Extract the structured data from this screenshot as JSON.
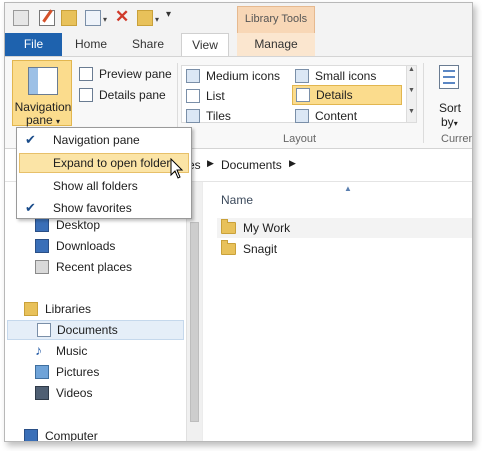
{
  "contextual_tab": {
    "label": "Library Tools"
  },
  "tabs": {
    "file": "File",
    "home": "Home",
    "share": "Share",
    "view": "View",
    "manage": "Manage"
  },
  "ribbon": {
    "navigation_pane_line1": "Navigation",
    "navigation_pane_line2": "pane",
    "preview_pane": "Preview pane",
    "details_pane": "Details pane",
    "layout": {
      "medium_icons": "Medium icons",
      "small_icons": "Small icons",
      "list": "List",
      "details": "Details",
      "tiles": "Tiles",
      "content": "Content",
      "group_label": "Layout"
    },
    "sort_line1": "Sort",
    "sort_line2": "by",
    "current_group_partial": "Curren"
  },
  "address_bar": {
    "libraries_partial": "es",
    "documents": "Documents"
  },
  "nav_menu": {
    "items": [
      {
        "label": "Navigation pane",
        "checked": true
      },
      {
        "label": "Expand to open folder",
        "checked": false,
        "highlighted": true
      },
      {
        "label": "Show all folders",
        "checked": false
      },
      {
        "label": "Show favorites",
        "checked": true
      }
    ]
  },
  "nav_pane": {
    "desktop": "Desktop",
    "downloads": "Downloads",
    "recent_places": "Recent places",
    "libraries": "Libraries",
    "documents": "Documents",
    "music": "Music",
    "pictures": "Pictures",
    "videos": "Videos",
    "computer": "Computer"
  },
  "content": {
    "column_name": "Name",
    "files": [
      "My Work",
      "Snagit"
    ]
  },
  "colors": {
    "file_tab": "#1e62ae",
    "highlight": "#fbdc8d",
    "context_tab": "#f8d7b6"
  }
}
